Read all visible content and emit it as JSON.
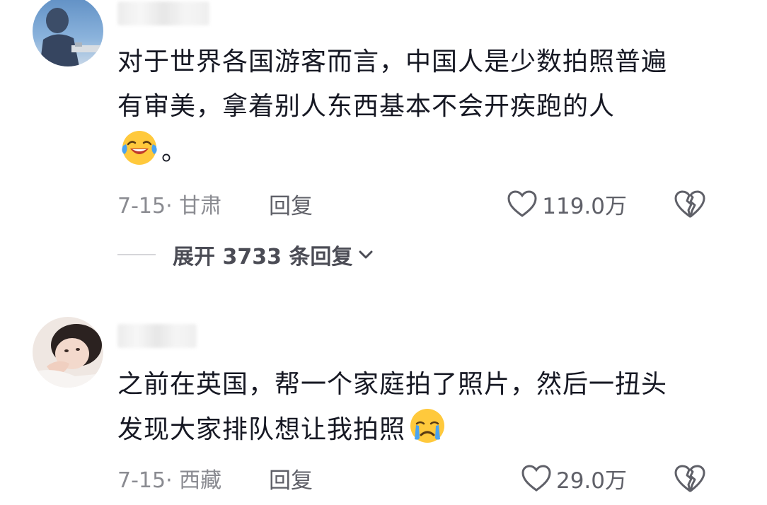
{
  "comments": [
    {
      "text_lines": [
        "对于世界各国游客而言，中国人是少数拍照普遍",
        "有审美，拿着别人东西基本不会开疾跑的人"
      ],
      "text_tail": "。",
      "emoji": "laughing-crying-emoji",
      "date_location": "7-15· 甘肃",
      "reply_label": "回复",
      "like_count": "119.0万",
      "expand_label": "展开 3733 条回复"
    },
    {
      "text_lines": [
        "之前在英国，帮一个家庭拍了照片，然后一扭头",
        "发现大家排队想让我拍照"
      ],
      "emoji": "crying-emoji",
      "date_location": "7-15· 西藏",
      "reply_label": "回复",
      "like_count": "29.0万"
    }
  ],
  "icons": {
    "like": "heart-outline-icon",
    "dislike": "broken-heart-icon",
    "expand_arrow": "chevron-down-icon"
  },
  "colors": {
    "text": "#161823",
    "meta": "#8a8b91",
    "emoji_yellow": "#ffc93c"
  }
}
